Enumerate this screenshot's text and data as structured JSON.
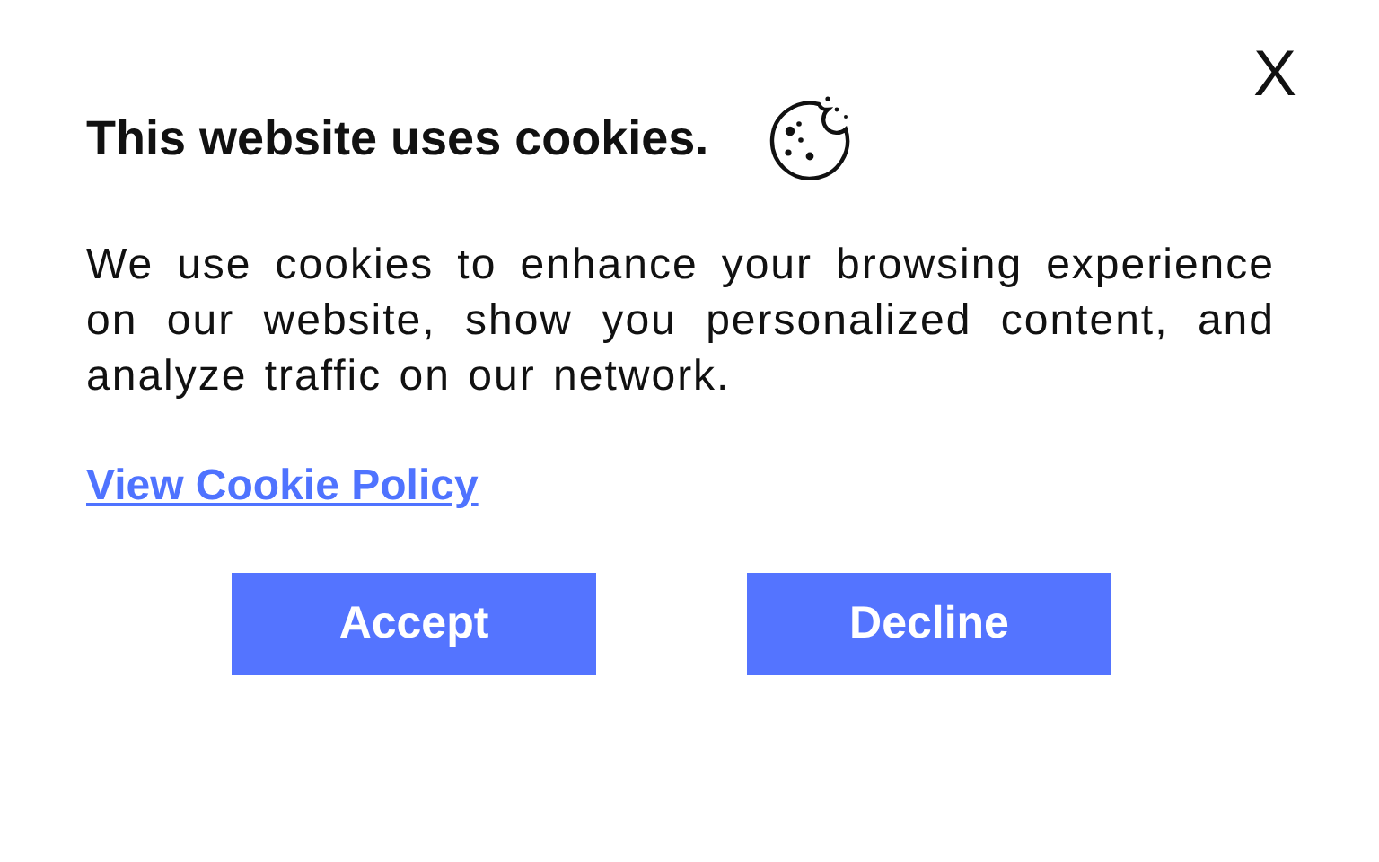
{
  "close": "X",
  "title": "This website uses cookies.",
  "message": "We use cookies to enhance your browsing experience on our website, show you personalized content, and analyze traffic on our network.",
  "link": "View Cookie Policy",
  "buttons": [
    "Accept",
    "Decline"
  ]
}
